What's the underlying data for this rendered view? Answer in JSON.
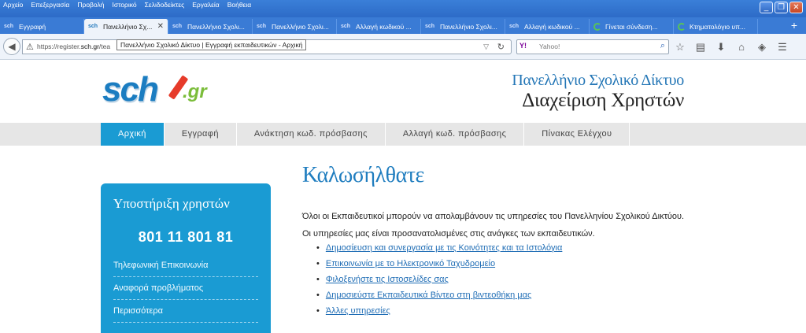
{
  "browser": {
    "menu": [
      "Αρχείο",
      "Επεξεργασία",
      "Προβολή",
      "Ιστορικό",
      "Σελιδοδείκτες",
      "Εργαλεία",
      "Βοήθεια"
    ],
    "window_buttons": [
      "_",
      "❐",
      "✕"
    ],
    "tabs": [
      {
        "title": "Εγγραφή",
        "icon": "sch-favicon",
        "active": false
      },
      {
        "title": "Πανελλήνιο Σχ...",
        "icon": "sch-favicon",
        "active": true
      },
      {
        "title": "Πανελλήνιο Σχολι...",
        "icon": "sch-favicon",
        "active": false
      },
      {
        "title": "Πανελλήνιο Σχολι...",
        "icon": "sch-favicon",
        "active": false
      },
      {
        "title": "Αλλαγή κωδικού ...",
        "icon": "sch-favicon",
        "active": false
      },
      {
        "title": "Πανελλήνιο Σχολι...",
        "icon": "sch-favicon",
        "active": false
      },
      {
        "title": "Αλλαγή κωδικού ...",
        "icon": "sch-favicon",
        "active": false
      },
      {
        "title": "Γίνεται σύνδεση...",
        "icon": "loading-spinner",
        "active": false
      },
      {
        "title": "Κτηματολόγιο υπ...",
        "icon": "loading-spinner",
        "active": false
      }
    ],
    "favicon_text": "sch",
    "new_tab_label": "+",
    "tooltip": "Πανελλήνιο Σχολικό Δίκτυο | Εγγραφή εκπαιδευτικών - Αρχική",
    "url_prefix": "https://register.",
    "url_host": "sch.gr",
    "url_rest": "/tea",
    "search_engine_label": "Y!",
    "search_placeholder": "Yahoo!",
    "toolbar_icons": [
      "star-icon",
      "reading-list-icon",
      "download-icon",
      "home-icon",
      "extension-icon",
      "menu-icon"
    ]
  },
  "site": {
    "logo_text": "sch",
    "logo_suffix": ".gr",
    "name_line1": "Πανελλήνιο Σχολικό Δίκτυο",
    "name_line2": "Διαχείριση Χρηστών",
    "menu": [
      "Αρχική",
      "Εγγραφή",
      "Ανάκτηση κωδ. πρόσβασης",
      "Αλλαγή κωδ. πρόσβασης",
      "Πίνακας Ελέγχου"
    ],
    "active_menu": "Αρχική",
    "sidebar": {
      "title": "Υποστήριξη χρηστών",
      "phone": "801 11 801 81",
      "links": [
        "Τηλεφωνική Επικοινωνία",
        "Αναφορά προβλήματος",
        "Περισσότερα"
      ]
    },
    "content": {
      "heading": "Καλωσήλθατε",
      "p1": "Όλοι οι Εκπαιδευτικοί μπορούν να απολαμβάνουν τις υπηρεσίες του Πανελληνίου Σχολικού Δικτύου.",
      "p2": "Οι υπηρεσίες μας είναι προσανατολισμένες στις ανάγκες των εκπαιδευτικών.",
      "services": [
        "Δημοσίευση και συνεργασία με τις Κοινότητες και τα Ιστολόγια",
        "Επικοινωνία με το Ηλεκτρονικό Ταχυδρομείο",
        "Φιλοξενήστε τις Ιστοσελίδες σας",
        "Δημοσιεύστε Εκπαιδευτικά Βίντεο στη βιντεοθήκη μας",
        "Άλλες υπηρεσίες"
      ]
    },
    "colors": {
      "accent": "#1a9bd3",
      "heading": "#1f7dbf",
      "link": "#1f6db5",
      "menu_bg": "#e6e6e6"
    }
  }
}
